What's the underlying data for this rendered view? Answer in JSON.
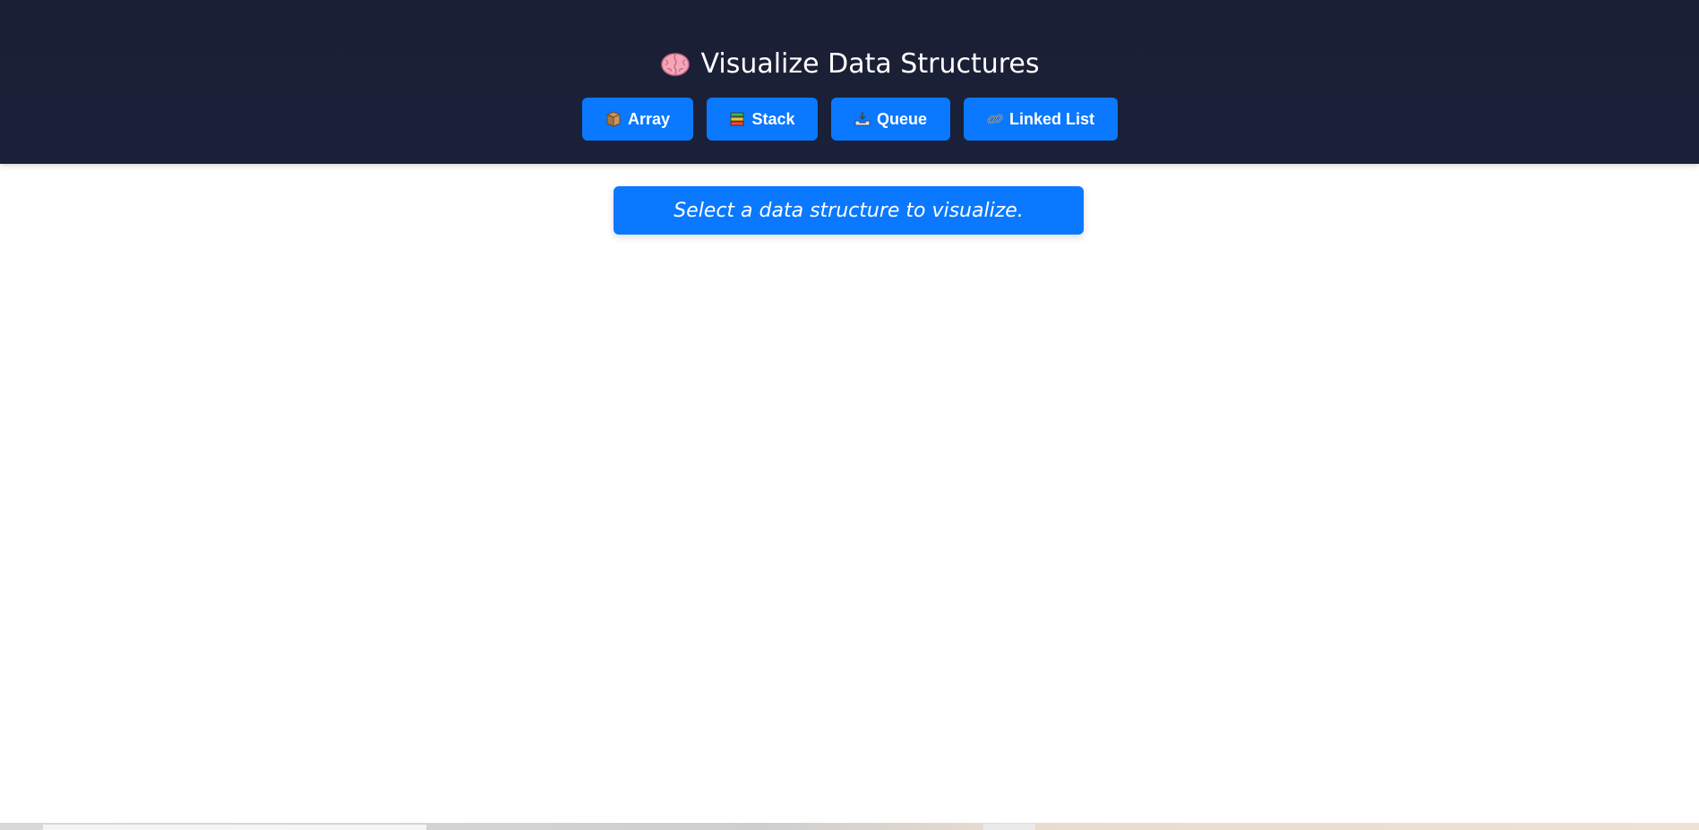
{
  "header": {
    "title": "Visualize Data Structures",
    "title_icon": "brain-icon"
  },
  "nav": {
    "items": [
      {
        "label": "Array",
        "icon": "package-icon"
      },
      {
        "label": "Stack",
        "icon": "books-icon"
      },
      {
        "label": "Queue",
        "icon": "inbox-tray-icon"
      },
      {
        "label": "Linked List",
        "icon": "link-icon"
      }
    ]
  },
  "status": {
    "message": "Select a data structure to visualize."
  },
  "colors": {
    "header_bg": "#1b1f35",
    "accent": "#0a78ff",
    "page_bg": "#ffffff"
  }
}
